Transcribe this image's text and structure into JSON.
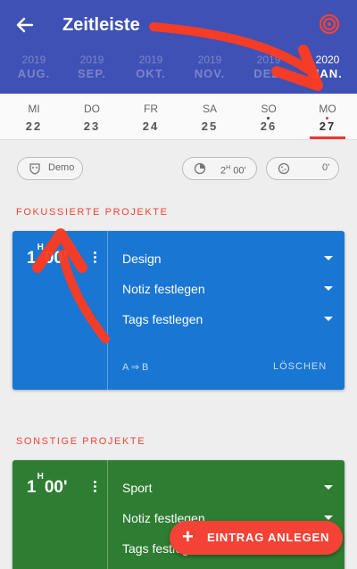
{
  "header": {
    "title": "Zeitleiste",
    "back_icon": "arrow-left-icon",
    "target_icon": "target-icon",
    "background": "#3f51b5"
  },
  "months": [
    {
      "year": "2019",
      "month": "AUG."
    },
    {
      "year": "2019",
      "month": "SEP."
    },
    {
      "year": "2019",
      "month": "OKT."
    },
    {
      "year": "2019",
      "month": "NOV."
    },
    {
      "year": "2019",
      "month": "DEZ."
    },
    {
      "year": "2020",
      "month": "JAN."
    }
  ],
  "days": [
    {
      "name": "MI",
      "date": "22"
    },
    {
      "name": "DO",
      "date": "23"
    },
    {
      "name": "FR",
      "date": "24"
    },
    {
      "name": "SA",
      "date": "25"
    },
    {
      "name": "SO",
      "date": "26"
    },
    {
      "name": "MO",
      "date": "27"
    }
  ],
  "chips": {
    "demo": "Demo",
    "time": "2",
    "time_unit": "H",
    "time_min": "00'",
    "break": "0'"
  },
  "focused": {
    "section_title": "FOKUSSIERTE PROJEKTE",
    "hours": "1",
    "hours_unit": "H",
    "minutes": "00'",
    "project": "Design",
    "note": "Notiz festlegen",
    "tags": "Tags festlegen",
    "ab": "A ⇒ B",
    "delete": "LÖSCHEN",
    "color": "#1976d2"
  },
  "other": {
    "section_title": "SONSTIGE PROJEKTE",
    "hours": "1",
    "hours_unit": "H",
    "minutes": "00'",
    "project": "Sport",
    "note": "Notiz festlegen",
    "tags": "Tags festlegen",
    "color": "#2e7d32"
  },
  "fab": {
    "label": "EINTRAG ANLEGEN",
    "icon": "plus-icon",
    "color": "#f44336"
  }
}
